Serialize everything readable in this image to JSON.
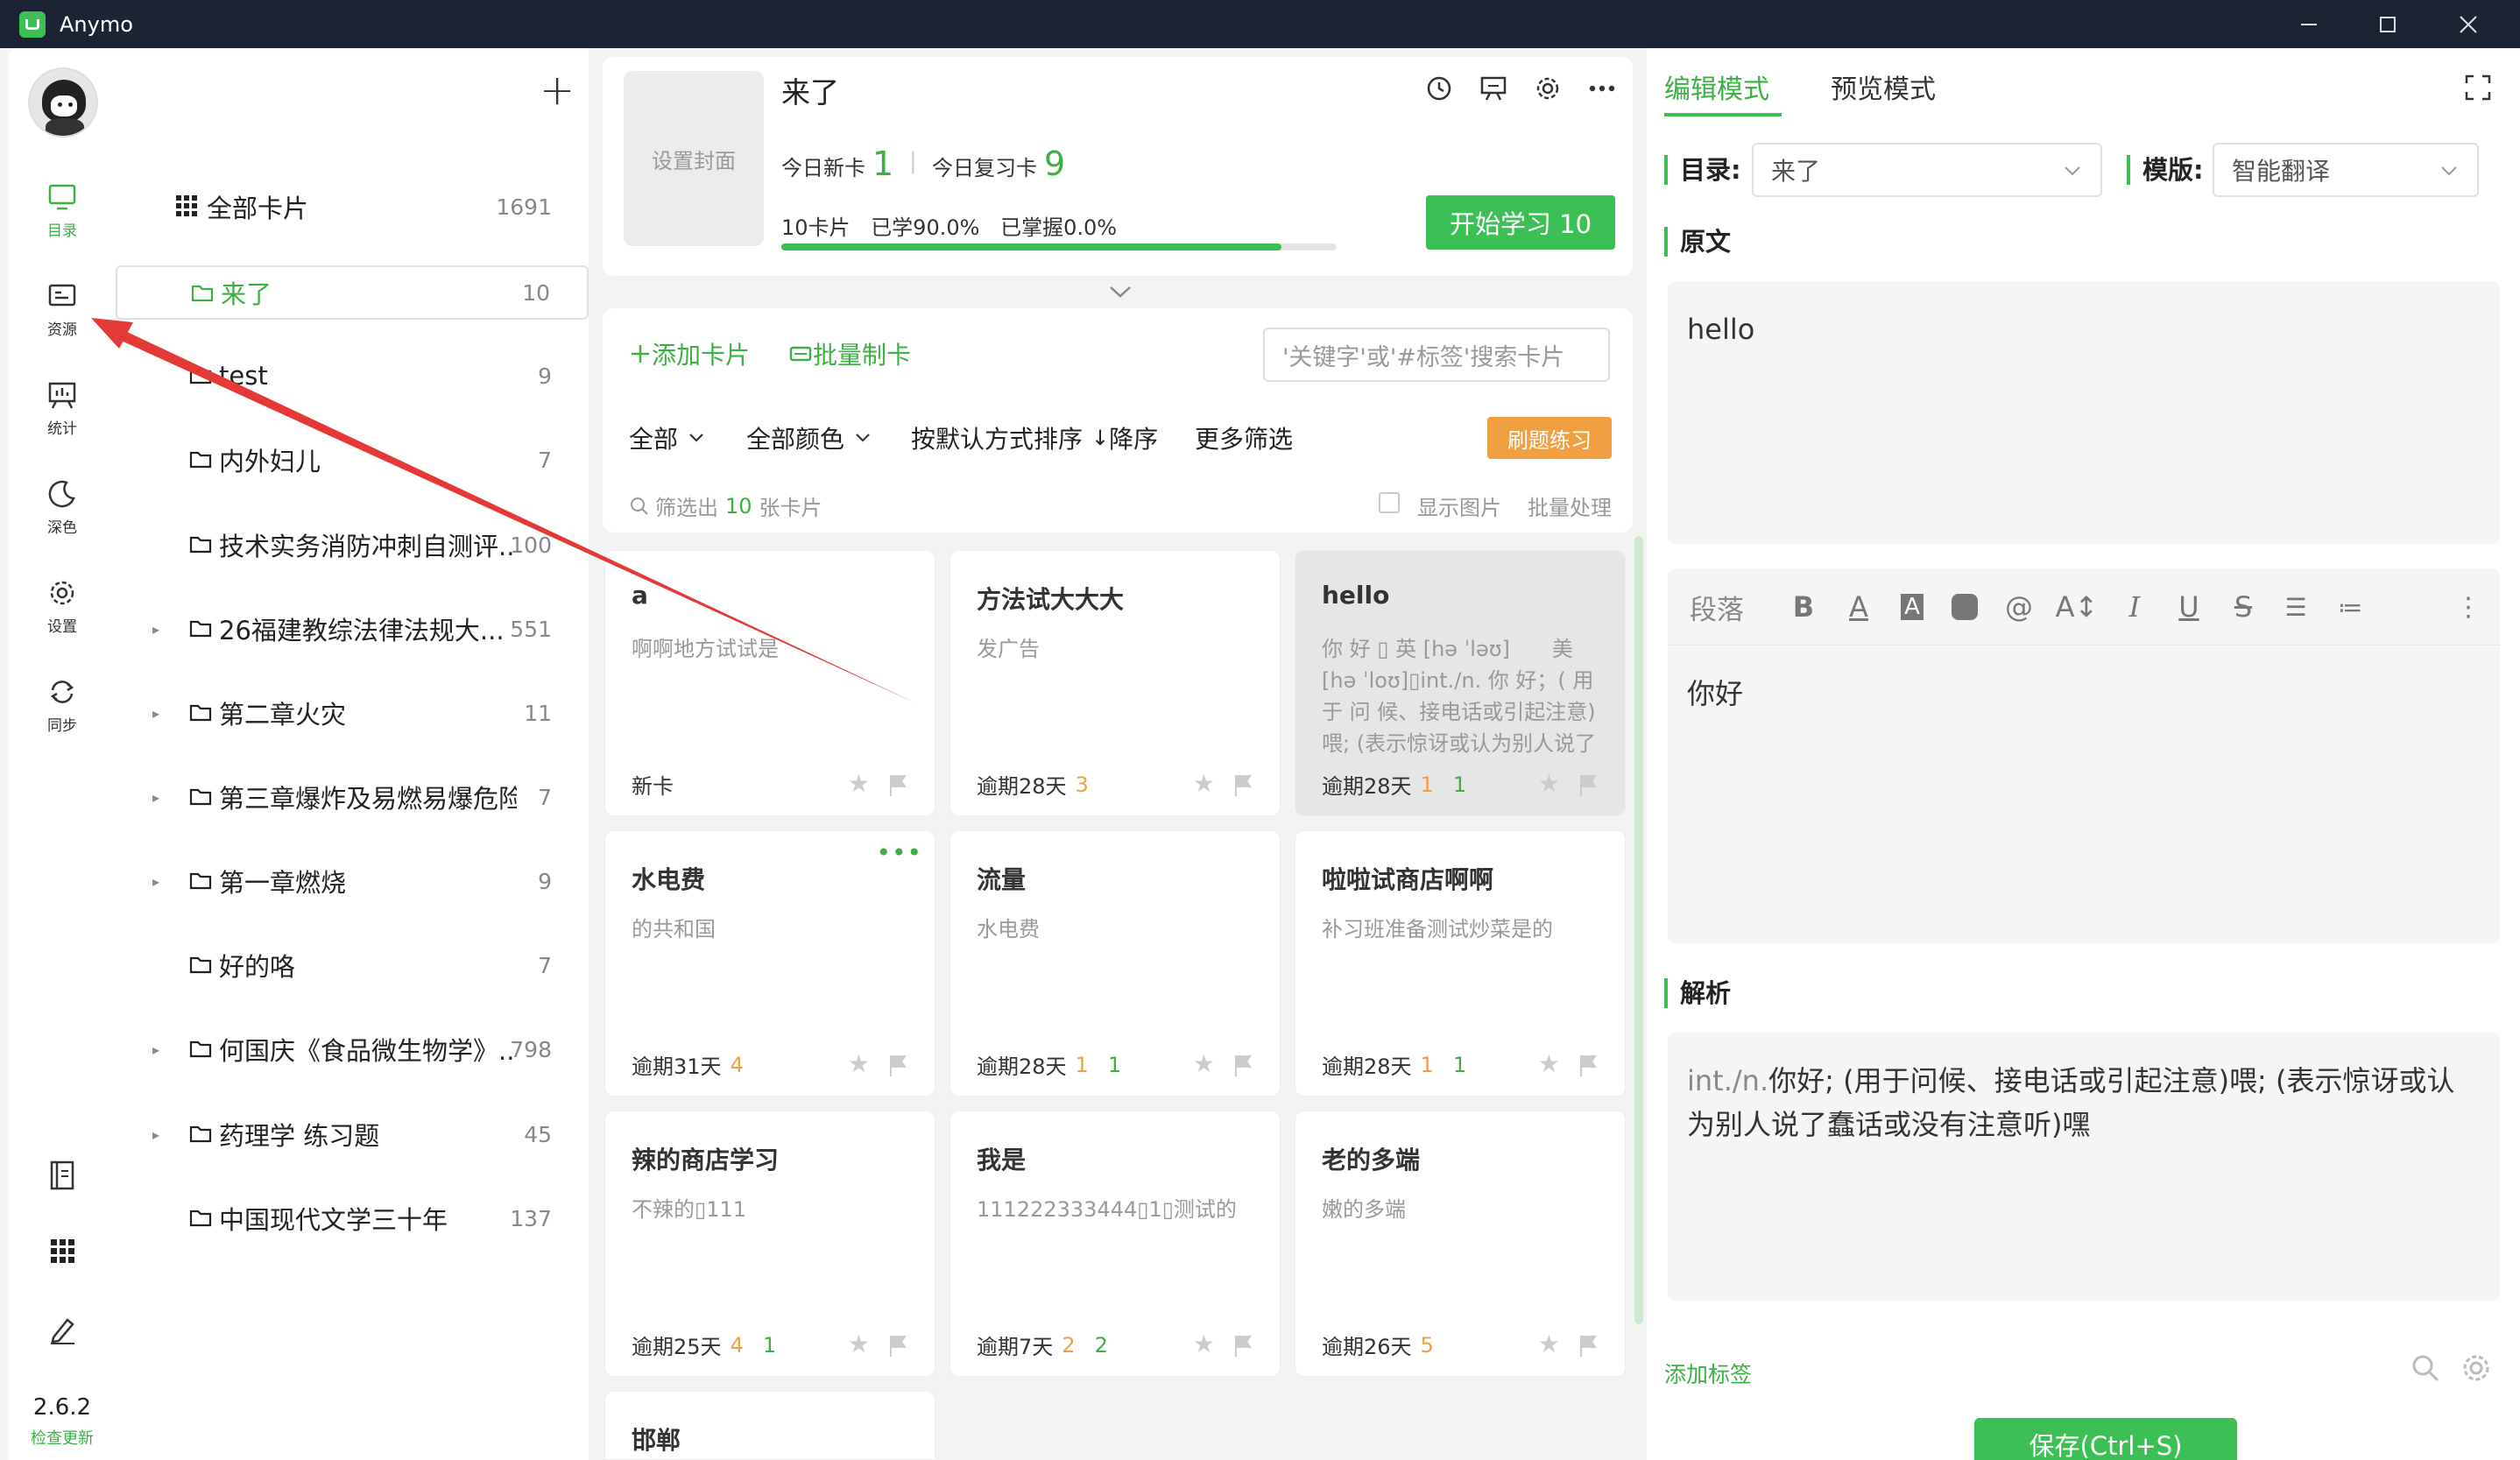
{
  "app": {
    "title": "Anymo",
    "version": "2.6.2",
    "check_update": "检查更新"
  },
  "rail": {
    "items": [
      {
        "label": "目录",
        "icon": "monitor-icon"
      },
      {
        "label": "资源",
        "icon": "resource-icon"
      },
      {
        "label": "统计",
        "icon": "chart-board-icon"
      },
      {
        "label": "深色",
        "icon": "moon-icon"
      },
      {
        "label": "设置",
        "icon": "gear-icon"
      },
      {
        "label": "同步",
        "icon": "sync-icon"
      }
    ],
    "bottom_icons": [
      "book-icon",
      "grid-icon",
      "pen-icon"
    ]
  },
  "folders": {
    "all": {
      "name": "全部卡片",
      "count": "1691"
    },
    "items": [
      {
        "name": "来了",
        "count": "10"
      },
      {
        "name": "test",
        "count": "9"
      },
      {
        "name": "内外妇儿",
        "count": "7"
      },
      {
        "name": "技术实务消防冲刺自测评...",
        "count": "100"
      },
      {
        "name": "26福建教综法律法规大...",
        "count": "551"
      },
      {
        "name": "第二章火灾",
        "count": "11"
      },
      {
        "name": "第三章爆炸及易燃易爆危险...",
        "count": "7"
      },
      {
        "name": "第一章燃烧",
        "count": "9"
      },
      {
        "name": "好的咯",
        "count": "7"
      },
      {
        "name": "何国庆《食品微生物学》...",
        "count": "798"
      },
      {
        "name": "药理学 练习题",
        "count": "45"
      },
      {
        "name": "中国现代文学三十年",
        "count": "137"
      }
    ]
  },
  "deck": {
    "cover_label": "设置封面",
    "title": "来了",
    "new_today_label": "今日新卡",
    "new_today": "1",
    "review_today_label": "今日复习卡",
    "review_today": "9",
    "cards_text": "10卡片",
    "learned_text": "已学90.0%",
    "mastered_text": "已掌握0.0%",
    "progress": 0.9,
    "start_label": "开始学习 10"
  },
  "toolbar": {
    "add_card": "添加卡片",
    "batch_make": "批量制卡",
    "search_placeholder": "'关键字'或'#标签'搜索卡片",
    "filter_all": "全部",
    "filter_color": "全部颜色",
    "sort": "按默认方式排序",
    "sort_dir": "降序",
    "more_filter": "更多筛选",
    "drill": "刷题练习",
    "filtered_prefix": "筛选出",
    "filtered_count": "10",
    "filtered_suffix": "张卡片",
    "show_images": "显示图片",
    "batch_process": "批量处理"
  },
  "cards": [
    {
      "title": "a",
      "body": "啊啊地方试试是",
      "status": "新卡",
      "orange": "",
      "green": ""
    },
    {
      "title": "方法试大大大",
      "body": "发广告",
      "status": "逾期28天",
      "orange": "3",
      "green": ""
    },
    {
      "title": "hello",
      "body": "你 好 ▯ 英 [hə ˈləʊ]　　美 [hə ˈloʊ]▯int./n. 你 好；( 用 于 问 候、接电话或引起注意)喂; (表示惊讶或认为别人说了蠢话...",
      "status": "逾期28天",
      "orange": "1",
      "green": "1"
    },
    {
      "title": "水电费",
      "body": "的共和国",
      "status": "逾期31天",
      "orange": "4",
      "green": ""
    },
    {
      "title": "流量",
      "body": "水电费",
      "status": "逾期28天",
      "orange": "1",
      "green": "1"
    },
    {
      "title": "啦啦试商店啊啊",
      "body": "补习班准备测试炒菜是的",
      "status": "逾期28天",
      "orange": "1",
      "green": "1"
    },
    {
      "title": "辣的商店学习",
      "body": "不辣的▯111",
      "status": "逾期25天",
      "orange": "4",
      "green": "1"
    },
    {
      "title": "我是",
      "body": "111222333444▯1▯测试的",
      "status": "逾期7天",
      "orange": "2",
      "green": "2"
    },
    {
      "title": "老的多端",
      "body": "嫩的多端",
      "status": "逾期26天",
      "orange": "5",
      "green": ""
    },
    {
      "title": "邯郸",
      "body": "",
      "status": "",
      "orange": "",
      "green": ""
    }
  ],
  "editor": {
    "tab_edit": "编辑模式",
    "tab_preview": "预览模式",
    "dir_label": "目录:",
    "dir_value": "来了",
    "tpl_label": "模版:",
    "tpl_value": "智能翻译",
    "original_label": "原文",
    "original_text": "hello",
    "fmt_paragraph": "段落",
    "translation_text": "你好",
    "analysis_label": "解析",
    "analysis_prefix": "int./n.",
    "analysis_text": "你好; (用于问候、接电话或引起注意)喂; (表示惊讶或认为别人说了蠢话或没有注意听)嘿",
    "add_tag": "添加标签",
    "save": "保存(Ctrl+S)"
  },
  "colors": {
    "accent": "#3cc055",
    "orange": "#f0a040",
    "titlebar": "#1c2433",
    "annotation": "#e53935"
  }
}
